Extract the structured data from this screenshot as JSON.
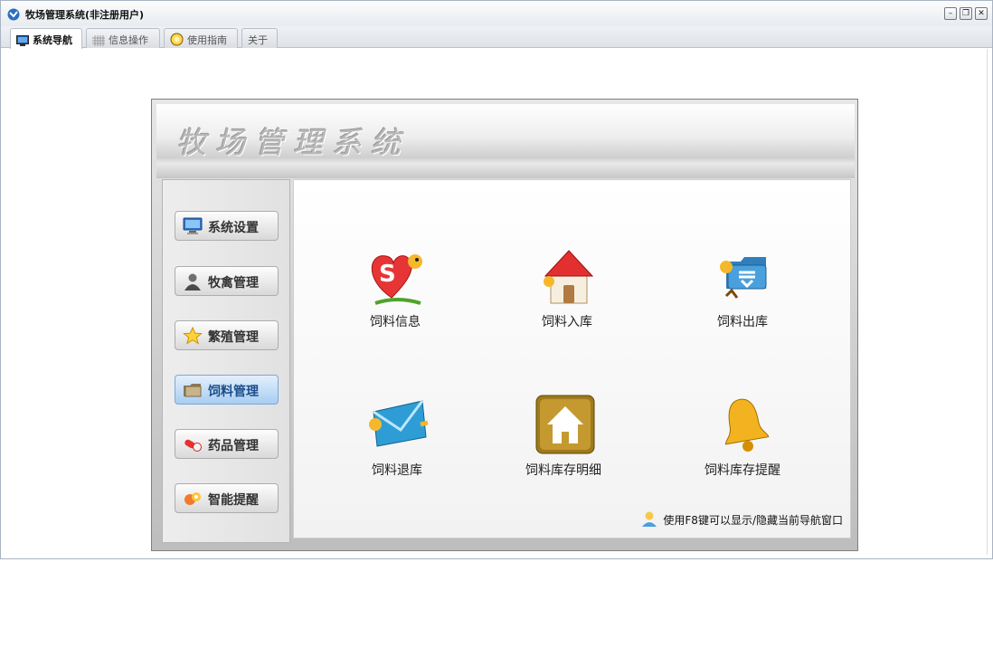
{
  "window": {
    "title": "牧场管理系统(非注册用户)"
  },
  "tabs": [
    {
      "label": "系统导航",
      "icon": "monitor-icon",
      "active": true
    },
    {
      "label": "信息操作",
      "icon": "grid-icon",
      "active": false
    },
    {
      "label": "使用指南",
      "icon": "help-circle-icon",
      "active": false
    },
    {
      "label": "关于",
      "icon": "",
      "active": false
    }
  ],
  "banner": {
    "title": "牧场管理系统"
  },
  "sidebar": {
    "items": [
      {
        "label": "系统设置",
        "icon": "monitor-icon"
      },
      {
        "label": "牧禽管理",
        "icon": "person-icon"
      },
      {
        "label": "繁殖管理",
        "icon": "star-icon"
      },
      {
        "label": "饲料管理",
        "icon": "folder-icon",
        "selected": true
      },
      {
        "label": "药品管理",
        "icon": "pill-icon"
      },
      {
        "label": "智能提醒",
        "icon": "reminder-icon"
      }
    ]
  },
  "tiles": [
    {
      "label": "饲料信息",
      "icon": "heart-bird-icon"
    },
    {
      "label": "饲料入库",
      "icon": "house-icon"
    },
    {
      "label": "饲料出库",
      "icon": "folder-download-icon"
    },
    {
      "label": "饲料退库",
      "icon": "envelope-icon"
    },
    {
      "label": "饲料库存明细",
      "icon": "home-box-icon"
    },
    {
      "label": "饲料库存提醒",
      "icon": "bell-icon"
    }
  ],
  "hint": {
    "text": "使用F8键可以显示/隐藏当前导航窗口",
    "icon": "user-tip-icon"
  },
  "colors": {
    "selected_nav": "#a8cdf2",
    "accent_blue": "#1c4e8c"
  }
}
